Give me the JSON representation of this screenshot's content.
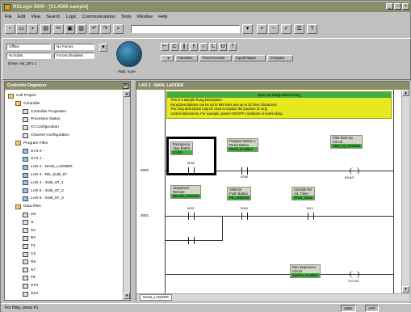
{
  "window": {
    "title": "RSLogix 5000 - [CLX500 sample]"
  },
  "menu": [
    "File",
    "Edit",
    "View",
    "Search",
    "Logic",
    "Communications",
    "Tools",
    "Window",
    "Help"
  ],
  "toolbar2": {
    "mode_label": "Offline",
    "mode_value": "No Forces",
    "edits_label": "No Edits",
    "edits_value": "Forces Disabled",
    "driver_label": "Driver: AB_DF1-1",
    "path_label": "Path: none",
    "tab_favorites": "Favorites",
    "tab_timer": "Timer/Counter",
    "tab_io": "Input/Output",
    "tab_compare": "Compare"
  },
  "tree": {
    "title": "Controller Organizer",
    "items": [
      {
        "label": "Cell Project",
        "indent": 1,
        "kind": "folder"
      },
      {
        "label": "Controller",
        "indent": 2,
        "kind": "folder"
      },
      {
        "label": "Controller Properties",
        "indent": 3,
        "kind": "item"
      },
      {
        "label": "Processor Status",
        "indent": 3,
        "kind": "item"
      },
      {
        "label": "IO Configuration",
        "indent": 3,
        "kind": "item"
      },
      {
        "label": "Channel Configuration",
        "indent": 3,
        "kind": "item"
      },
      {
        "label": "Program Files",
        "indent": 2,
        "kind": "folder"
      },
      {
        "label": "SYS 0 -",
        "indent": 3,
        "kind": "prog"
      },
      {
        "label": "SYS 1 -",
        "indent": 3,
        "kind": "prog"
      },
      {
        "label": "LAD 2 - MAIN_LADDER",
        "indent": 3,
        "kind": "prog"
      },
      {
        "label": "LAD 3 - RD_SUB_87",
        "indent": 3,
        "kind": "prog"
      },
      {
        "label": "LAD 4 - SUB_87_1",
        "indent": 3,
        "kind": "prog"
      },
      {
        "label": "LAD 5 - SUB_87_2",
        "indent": 3,
        "kind": "prog"
      },
      {
        "label": "LAD 6 - SUB_87_3",
        "indent": 3,
        "kind": "prog"
      },
      {
        "label": "Data Files",
        "indent": 2,
        "kind": "folder"
      },
      {
        "label": "O0",
        "indent": 3,
        "kind": "item"
      },
      {
        "label": "I1",
        "indent": 3,
        "kind": "item"
      },
      {
        "label": "S2",
        "indent": 3,
        "kind": "item"
      },
      {
        "label": "B3",
        "indent": 3,
        "kind": "item"
      },
      {
        "label": "T4",
        "indent": 3,
        "kind": "item"
      },
      {
        "label": "C5",
        "indent": 3,
        "kind": "item"
      },
      {
        "label": "R6",
        "indent": 3,
        "kind": "item"
      },
      {
        "label": "N7",
        "indent": 3,
        "kind": "item"
      },
      {
        "label": "F8",
        "indent": 3,
        "kind": "item"
      },
      {
        "label": "ST9",
        "indent": 3,
        "kind": "item"
      },
      {
        "label": "N10",
        "indent": 3,
        "kind": "item"
      }
    ]
  },
  "ladder": {
    "title": "LAD 2 - MAIN_LADDER",
    "tab_label": "MAIN_LADDER",
    "comment": {
      "header": "Start Up Diagnostics Rung",
      "lines": [
        "This is a sample Rung Description.",
        "Rung Descriptions can be up to 999 lines and up to 32 lines characters.",
        "The rung description may be used to explain the purpose of rung",
        "control instructions. For example, power ON/OFF conditions or interlocking."
      ]
    },
    "rungs": [
      {
        "num": "0000"
      },
      {
        "num": "0001"
      }
    ],
    "tags": [
      {
        "label": "Emergency",
        "sub": "Stop Button",
        "tag": "I:0.0/0",
        "addr": "0000"
      },
      {
        "label": "Program Button 1",
        "sub": "Reset Button",
        "tag": "Reset_Enabled",
        "addr": "0006"
      },
      {
        "label": "Pilot Start Up",
        "sub": "Circuit",
        "tag": "Start_Up_Enabled",
        "addr": "B3:0/0"
      },
      {
        "label": "Sequencer",
        "sub": "Remote",
        "tag": "Remote_Enabled",
        "addr": "0002"
      },
      {
        "label": "Selector",
        "sub": "Push Button",
        "tag": "PB_Selected",
        "addr": "0000"
      },
      {
        "label": "Console Rd",
        "sub": "Ad. Timer",
        "tag": "Timer_Done",
        "addr": "B3:1"
      },
      {
        "label": "Run Sequencer",
        "sub": "Circuit",
        "tag": "System_Enabled",
        "addr": "O:0.0/0"
      }
    ]
  },
  "status": {
    "text": "For Help, press F1",
    "right1": "256K",
    "right2": "APP"
  }
}
